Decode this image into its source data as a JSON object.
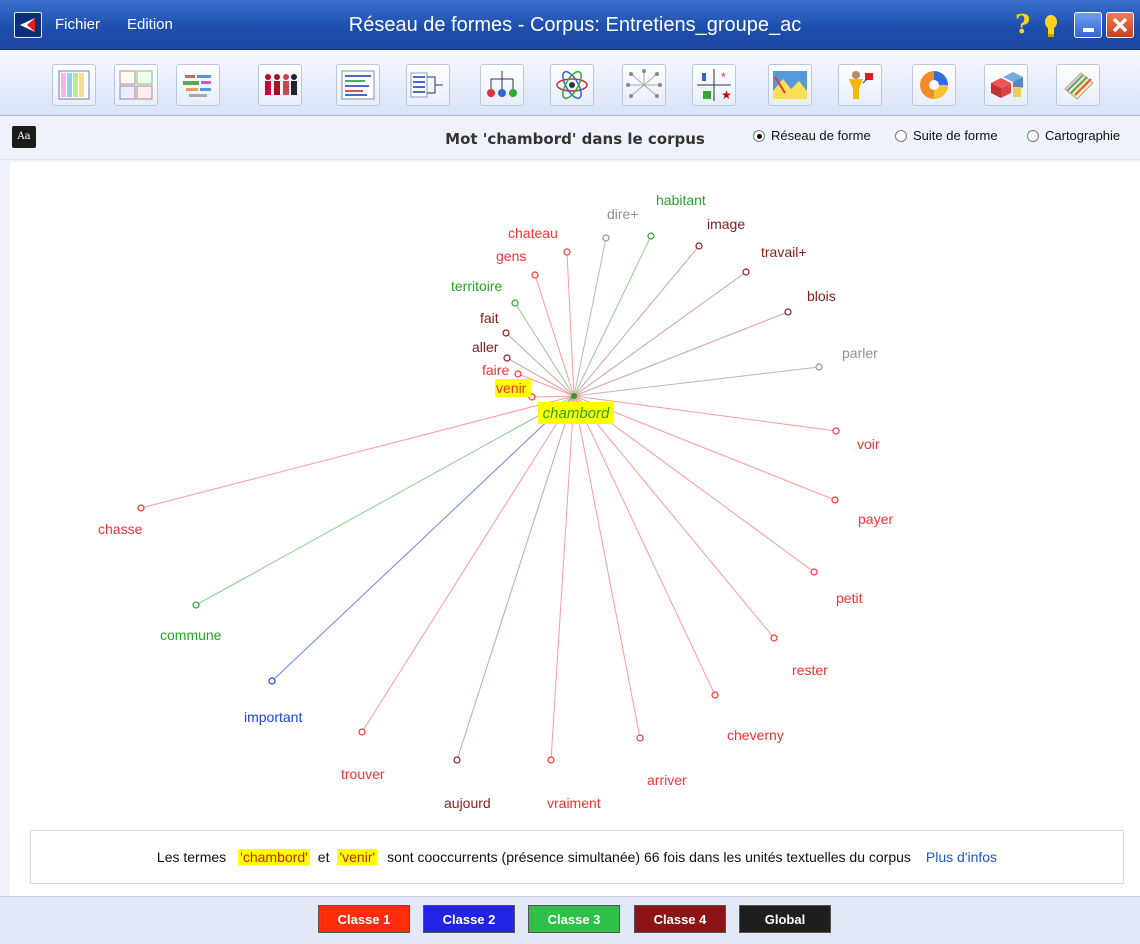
{
  "window": {
    "menu_file": "Fichier",
    "menu_edit": "Edition",
    "title": "Réseau de formes - Corpus: Entretiens_groupe_ac",
    "help_glyph": "?"
  },
  "toolbar_icons": [
    "table-icon",
    "map-icon",
    "word-cloud-icon",
    "people-icon",
    "text-list-icon",
    "tree-branch-icon",
    "dendrogram-icon",
    "atom-icon",
    "network-icon",
    "factor-plot-icon",
    "landscape-map-icon",
    "presenter-icon",
    "radial-chart-icon",
    "cubes-icon",
    "notebook-icon"
  ],
  "options": {
    "font_icon": "Aa",
    "heading": "Mot 'chambord' dans le corpus",
    "radio_network": "Réseau de forme",
    "radio_sequence": "Suite de forme",
    "radio_map": "Cartographie",
    "selected": "Réseau de forme"
  },
  "graph": {
    "center": "chambord",
    "highlighted": "venir",
    "class_colors": {
      "c1": "#ff3030",
      "c2": "#2040e8",
      "c3": "#2aa12a",
      "c4": "#8b1a1a",
      "global": "#909090"
    },
    "nodes": [
      {
        "label": "chasse",
        "class": "c1"
      },
      {
        "label": "commune",
        "class": "c3"
      },
      {
        "label": "important",
        "class": "c2"
      },
      {
        "label": "trouver",
        "class": "c1"
      },
      {
        "label": "aujourd",
        "class": "c4"
      },
      {
        "label": "vraiment",
        "class": "c1"
      },
      {
        "label": "arriver",
        "class": "c1"
      },
      {
        "label": "cheverny",
        "class": "c1"
      },
      {
        "label": "rester",
        "class": "c1"
      },
      {
        "label": "petit",
        "class": "c1"
      },
      {
        "label": "payer",
        "class": "c1"
      },
      {
        "label": "voir",
        "class": "c1"
      },
      {
        "label": "parler",
        "class": "global"
      },
      {
        "label": "blois",
        "class": "c4"
      },
      {
        "label": "travail+",
        "class": "c4"
      },
      {
        "label": "image",
        "class": "c4"
      },
      {
        "label": "habitant",
        "class": "c3"
      },
      {
        "label": "dire+",
        "class": "global"
      },
      {
        "label": "chateau",
        "class": "c1"
      },
      {
        "label": "gens",
        "class": "c1"
      },
      {
        "label": "territoire",
        "class": "c3"
      },
      {
        "label": "fait",
        "class": "c4"
      },
      {
        "label": "aller",
        "class": "c4"
      },
      {
        "label": "faire",
        "class": "c1"
      },
      {
        "label": "venir",
        "class": "c1"
      }
    ]
  },
  "info": {
    "prefix": "Les termes",
    "term1": "'chambord'",
    "conj": "et",
    "term2": "'venir'",
    "suffix": "sont cooccurrents (présence simultanée) 66 fois dans les unités textuelles du corpus",
    "more_link": "Plus d'infos"
  },
  "legend": [
    {
      "label": "Classe 1",
      "color": "#ff2d0a"
    },
    {
      "label": "Classe 2",
      "color": "#2323e6"
    },
    {
      "label": "Classe 3",
      "color": "#2fc04a"
    },
    {
      "label": "Classe 4",
      "color": "#8c1414"
    },
    {
      "label": "Global",
      "color": "#1e1e1e"
    }
  ]
}
